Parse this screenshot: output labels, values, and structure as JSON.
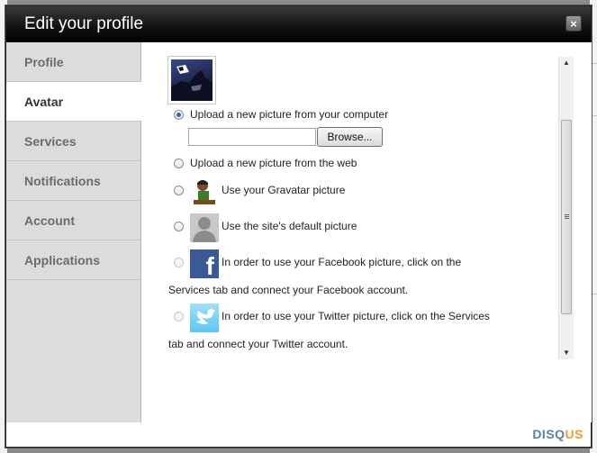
{
  "dialog": {
    "title": "Edit your profile",
    "close_label": "×"
  },
  "sidebar": {
    "items": [
      {
        "label": "Profile"
      },
      {
        "label": "Avatar"
      },
      {
        "label": "Services"
      },
      {
        "label": "Notifications"
      },
      {
        "label": "Account"
      },
      {
        "label": "Applications"
      }
    ],
    "active_index": 1
  },
  "avatar": {
    "options": [
      {
        "label": "Upload a new picture from your computer",
        "selected": true,
        "enabled": true
      },
      {
        "label": "Upload a new picture from the web",
        "selected": false,
        "enabled": true
      },
      {
        "label": "Use your Gravatar picture",
        "selected": false,
        "enabled": true
      },
      {
        "label": "Use the site's default picture",
        "selected": false,
        "enabled": true
      },
      {
        "label": "In order to use your Facebook picture, click on the",
        "continuation": "Services tab and connect your Facebook account.",
        "selected": false,
        "enabled": false
      },
      {
        "label": "In order to use your Twitter picture, click on the Services",
        "continuation": "tab and connect your Twitter account.",
        "selected": false,
        "enabled": false
      }
    ],
    "upload": {
      "file_value": "",
      "browse_label": "Browse..."
    }
  },
  "footer": {
    "brand_a": "DISQ",
    "brand_b": "US"
  },
  "colors": {
    "titlebar": "#000000",
    "sidebar": "#dcdcdc",
    "brand": "#5a7fa3",
    "brand_accent": "#f09a2e"
  }
}
